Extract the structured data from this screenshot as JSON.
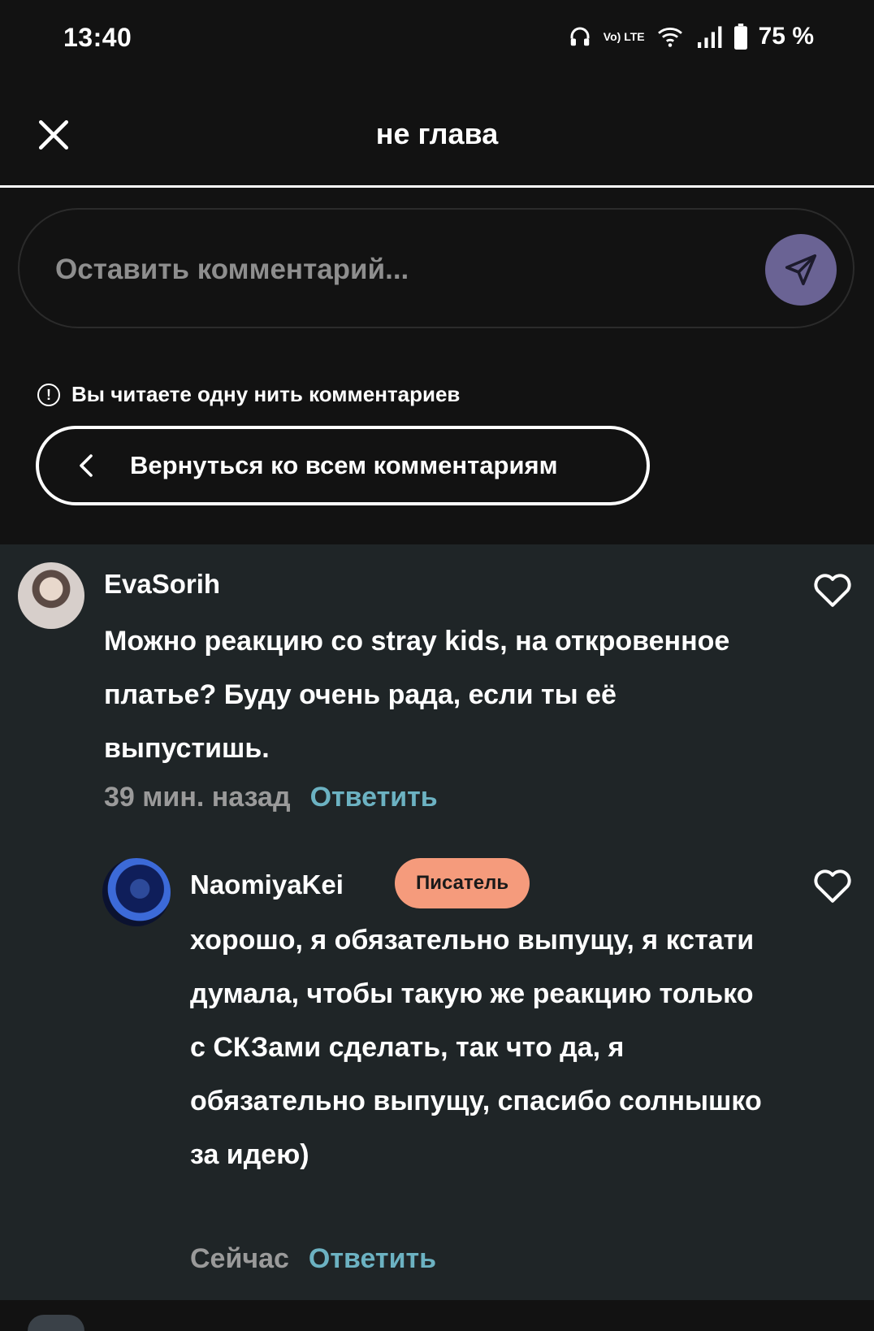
{
  "status_bar": {
    "time": "13:40",
    "volte": "Vo) LTE",
    "battery": "75 %",
    "icons": [
      "headphones-icon",
      "volte-icon",
      "wifi-icon",
      "signal-icon",
      "battery-icon"
    ]
  },
  "header": {
    "title": "не глава",
    "close_icon": "close-icon"
  },
  "comment_input": {
    "placeholder": "Оставить комментарий...",
    "send_icon": "send-icon"
  },
  "thread": {
    "notice": "Вы читаете одну нить комментариев",
    "notice_icon": "info-icon",
    "back_button": "Вернуться ко всем комментариям"
  },
  "comments": [
    {
      "username": "EvaSorih",
      "text": "Можно реакцию со stray kids, на откровенное платье? Буду очень рада, если ты её выпустишь.",
      "time": "39 мин. назад",
      "reply_label": "Ответить"
    },
    {
      "username": "NaomiyaKei",
      "badge": "Писатель",
      "text": "хорошо, я обязательно выпущу, я кстати думала, чтобы такую же реакцию только с СКЗами сделать, так что да, я обязательно выпущу, спасибо солнышко за идею)",
      "time": "Сейчас",
      "reply_label": "Ответить"
    }
  ],
  "colors": {
    "background": "#121212",
    "comments_background": "#1f2527",
    "send_button": "#6a6394",
    "reply_link": "#6cb2c2",
    "writer_badge": "#f59b7c",
    "muted_text": "#9a9a9a"
  }
}
